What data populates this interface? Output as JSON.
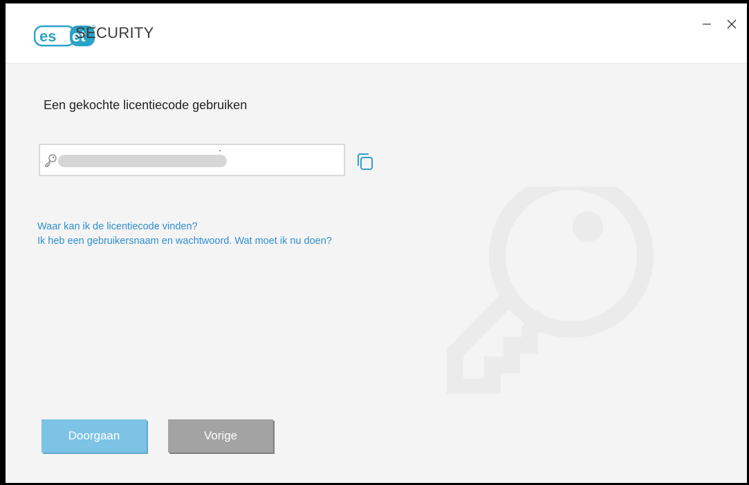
{
  "window": {
    "product_name": "SECURITY",
    "logo_text": "eset",
    "colors": {
      "brand": "#2aa3c8",
      "link": "#2f8fcf",
      "primary_button": "#7cc3e6",
      "secondary_button": "#a3a3a3"
    }
  },
  "page": {
    "heading": "Een gekochte licentiecode gebruiken"
  },
  "license_input": {
    "value": "",
    "prefix_icon": "key-icon",
    "paste_icon": "copy-icon"
  },
  "links": [
    {
      "label": "Waar kan ik de licentiecode vinden?"
    },
    {
      "label": "Ik heb een gebruikersnaam en wachtwoord. Wat moet ik nu doen?"
    }
  ],
  "buttons": {
    "continue_label": "Doorgaan",
    "back_label": "Vorige"
  }
}
